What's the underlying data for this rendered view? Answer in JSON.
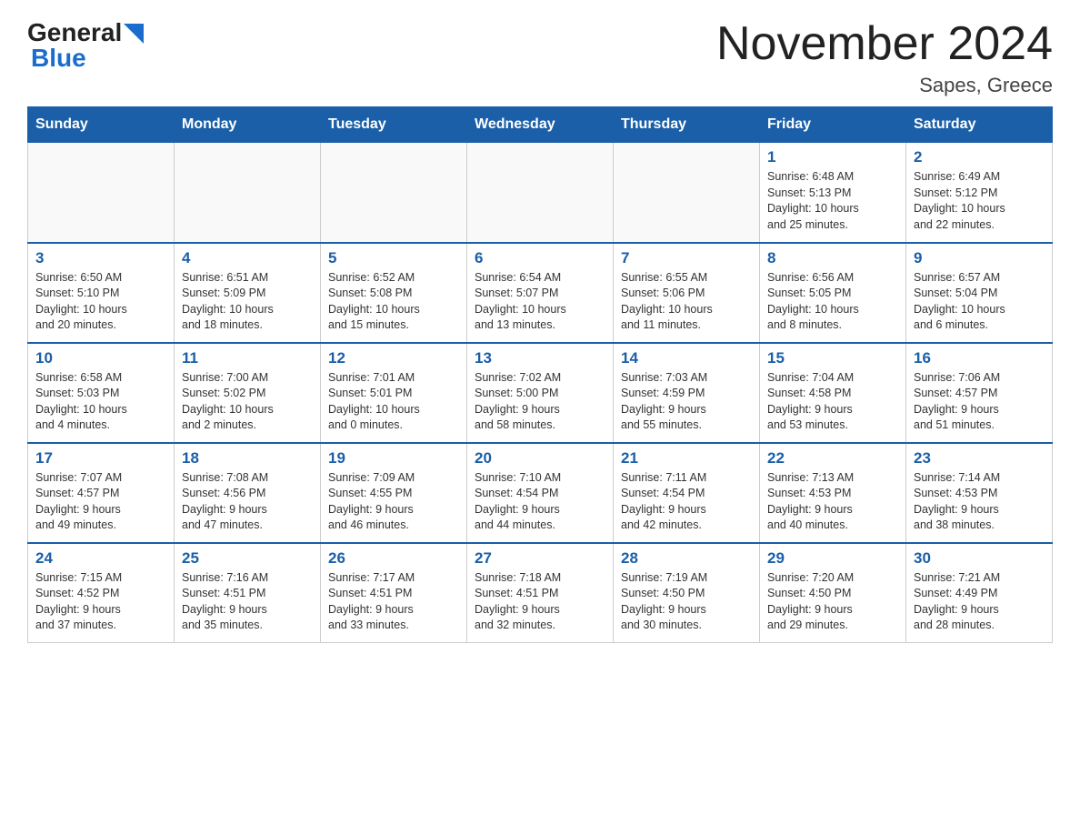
{
  "logo": {
    "general": "General",
    "blue": "Blue",
    "arrow": "▲"
  },
  "title": "November 2024",
  "subtitle": "Sapes, Greece",
  "days_of_week": [
    "Sunday",
    "Monday",
    "Tuesday",
    "Wednesday",
    "Thursday",
    "Friday",
    "Saturday"
  ],
  "weeks": [
    [
      {
        "day": "",
        "info": ""
      },
      {
        "day": "",
        "info": ""
      },
      {
        "day": "",
        "info": ""
      },
      {
        "day": "",
        "info": ""
      },
      {
        "day": "",
        "info": ""
      },
      {
        "day": "1",
        "info": "Sunrise: 6:48 AM\nSunset: 5:13 PM\nDaylight: 10 hours\nand 25 minutes."
      },
      {
        "day": "2",
        "info": "Sunrise: 6:49 AM\nSunset: 5:12 PM\nDaylight: 10 hours\nand 22 minutes."
      }
    ],
    [
      {
        "day": "3",
        "info": "Sunrise: 6:50 AM\nSunset: 5:10 PM\nDaylight: 10 hours\nand 20 minutes."
      },
      {
        "day": "4",
        "info": "Sunrise: 6:51 AM\nSunset: 5:09 PM\nDaylight: 10 hours\nand 18 minutes."
      },
      {
        "day": "5",
        "info": "Sunrise: 6:52 AM\nSunset: 5:08 PM\nDaylight: 10 hours\nand 15 minutes."
      },
      {
        "day": "6",
        "info": "Sunrise: 6:54 AM\nSunset: 5:07 PM\nDaylight: 10 hours\nand 13 minutes."
      },
      {
        "day": "7",
        "info": "Sunrise: 6:55 AM\nSunset: 5:06 PM\nDaylight: 10 hours\nand 11 minutes."
      },
      {
        "day": "8",
        "info": "Sunrise: 6:56 AM\nSunset: 5:05 PM\nDaylight: 10 hours\nand 8 minutes."
      },
      {
        "day": "9",
        "info": "Sunrise: 6:57 AM\nSunset: 5:04 PM\nDaylight: 10 hours\nand 6 minutes."
      }
    ],
    [
      {
        "day": "10",
        "info": "Sunrise: 6:58 AM\nSunset: 5:03 PM\nDaylight: 10 hours\nand 4 minutes."
      },
      {
        "day": "11",
        "info": "Sunrise: 7:00 AM\nSunset: 5:02 PM\nDaylight: 10 hours\nand 2 minutes."
      },
      {
        "day": "12",
        "info": "Sunrise: 7:01 AM\nSunset: 5:01 PM\nDaylight: 10 hours\nand 0 minutes."
      },
      {
        "day": "13",
        "info": "Sunrise: 7:02 AM\nSunset: 5:00 PM\nDaylight: 9 hours\nand 58 minutes."
      },
      {
        "day": "14",
        "info": "Sunrise: 7:03 AM\nSunset: 4:59 PM\nDaylight: 9 hours\nand 55 minutes."
      },
      {
        "day": "15",
        "info": "Sunrise: 7:04 AM\nSunset: 4:58 PM\nDaylight: 9 hours\nand 53 minutes."
      },
      {
        "day": "16",
        "info": "Sunrise: 7:06 AM\nSunset: 4:57 PM\nDaylight: 9 hours\nand 51 minutes."
      }
    ],
    [
      {
        "day": "17",
        "info": "Sunrise: 7:07 AM\nSunset: 4:57 PM\nDaylight: 9 hours\nand 49 minutes."
      },
      {
        "day": "18",
        "info": "Sunrise: 7:08 AM\nSunset: 4:56 PM\nDaylight: 9 hours\nand 47 minutes."
      },
      {
        "day": "19",
        "info": "Sunrise: 7:09 AM\nSunset: 4:55 PM\nDaylight: 9 hours\nand 46 minutes."
      },
      {
        "day": "20",
        "info": "Sunrise: 7:10 AM\nSunset: 4:54 PM\nDaylight: 9 hours\nand 44 minutes."
      },
      {
        "day": "21",
        "info": "Sunrise: 7:11 AM\nSunset: 4:54 PM\nDaylight: 9 hours\nand 42 minutes."
      },
      {
        "day": "22",
        "info": "Sunrise: 7:13 AM\nSunset: 4:53 PM\nDaylight: 9 hours\nand 40 minutes."
      },
      {
        "day": "23",
        "info": "Sunrise: 7:14 AM\nSunset: 4:53 PM\nDaylight: 9 hours\nand 38 minutes."
      }
    ],
    [
      {
        "day": "24",
        "info": "Sunrise: 7:15 AM\nSunset: 4:52 PM\nDaylight: 9 hours\nand 37 minutes."
      },
      {
        "day": "25",
        "info": "Sunrise: 7:16 AM\nSunset: 4:51 PM\nDaylight: 9 hours\nand 35 minutes."
      },
      {
        "day": "26",
        "info": "Sunrise: 7:17 AM\nSunset: 4:51 PM\nDaylight: 9 hours\nand 33 minutes."
      },
      {
        "day": "27",
        "info": "Sunrise: 7:18 AM\nSunset: 4:51 PM\nDaylight: 9 hours\nand 32 minutes."
      },
      {
        "day": "28",
        "info": "Sunrise: 7:19 AM\nSunset: 4:50 PM\nDaylight: 9 hours\nand 30 minutes."
      },
      {
        "day": "29",
        "info": "Sunrise: 7:20 AM\nSunset: 4:50 PM\nDaylight: 9 hours\nand 29 minutes."
      },
      {
        "day": "30",
        "info": "Sunrise: 7:21 AM\nSunset: 4:49 PM\nDaylight: 9 hours\nand 28 minutes."
      }
    ]
  ]
}
